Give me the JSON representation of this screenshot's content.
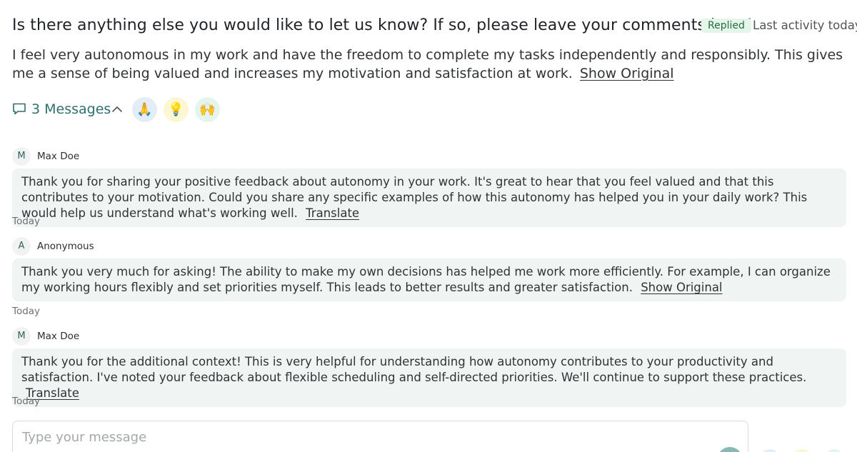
{
  "header": {
    "question": "Is there anything else you would like to let us know? If so, please leave your comments here!",
    "status_badge": "Replied",
    "activity": "Last activity today"
  },
  "answer": {
    "text": "I feel very autonomous in my work and have the freedom to complete my tasks independently and responsibly. This gives me a sense of being valued and increases my motivation and satisfaction at work.",
    "show_original": "Show Original"
  },
  "toolbar": {
    "messages_label": "3 Messages",
    "reactions": [
      {
        "emoji": "🙏",
        "icon": "folded-hands-icon",
        "bg": "#e3edf7"
      },
      {
        "emoji": "💡",
        "icon": "light-bulb-icon",
        "bg": "#fdf6d3"
      },
      {
        "emoji": "🙌",
        "icon": "raised-hands-icon",
        "bg": "#e6f5ec"
      }
    ]
  },
  "comments": [
    {
      "initial": "M",
      "author": "Max Doe",
      "text": "Thank you for sharing your positive feedback about autonomy in your work. It's great to hear that you feel valued and that this contributes to your motivation. Could you share any specific examples of how this autonomy has helped you in your daily work? This would help us understand what's working well.",
      "action": "Translate",
      "date": "Today"
    },
    {
      "initial": "A",
      "author": "Anonymous",
      "text": "Thank you very much for asking! The ability to make my own decisions has helped me work more efficiently. For example, I can organize my working hours flexibly and set priorities myself. This leads to better results and greater satisfaction.",
      "action": "Show Original",
      "date": "Today"
    },
    {
      "initial": "M",
      "author": "Max Doe",
      "text": "Thank you for the additional context! This is very helpful for understanding how autonomy contributes to your productivity and satisfaction. I've noted your feedback about flexible scheduling and self-directed priorities. We'll continue to support these practices.",
      "action": "Translate",
      "date": "Today"
    }
  ],
  "composer": {
    "placeholder": "Type your message"
  },
  "colors": {
    "accent": "#2f6f6f",
    "bubble_bg": "#f0f5f3",
    "badge_bg": "#e4f6ea",
    "badge_text": "#2a6a43",
    "send_bg": "#8ab8b3"
  }
}
